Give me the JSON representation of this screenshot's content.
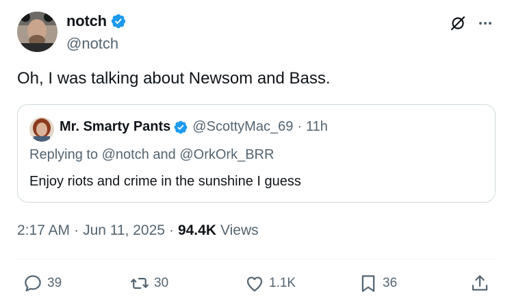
{
  "author": {
    "display_name": "notch",
    "handle": "@notch",
    "verified": true
  },
  "tweet": {
    "text": "Oh, I was talking about Newsom and Bass."
  },
  "quoted_tweet": {
    "display_name": "Mr. Smarty Pants",
    "handle": "@ScottyMac_69",
    "dot": "·",
    "time": "11h",
    "reply_prefix": "Replying to",
    "reply_to_1": "@notch",
    "reply_and": "and",
    "reply_to_2": "@OrkOrk_BRR",
    "text": "Enjoy riots and crime in the sunshine I guess"
  },
  "meta": {
    "time": "2:17 AM",
    "sep": "·",
    "date": "Jun 11, 2025",
    "views_count": "94.4K",
    "views_label": "Views"
  },
  "actions": {
    "replies": "39",
    "retweets": "30",
    "likes": "1.1K",
    "bookmarks": "36"
  },
  "colors": {
    "verified_blue": "#1d9bf0",
    "secondary_text": "#536471",
    "primary_text": "#0f1419",
    "border": "#cfd9de"
  },
  "icons": [
    "verified-badge-icon",
    "grok-icon",
    "more-icon",
    "reply-icon",
    "retweet-icon",
    "like-icon",
    "bookmark-icon",
    "share-icon"
  ]
}
